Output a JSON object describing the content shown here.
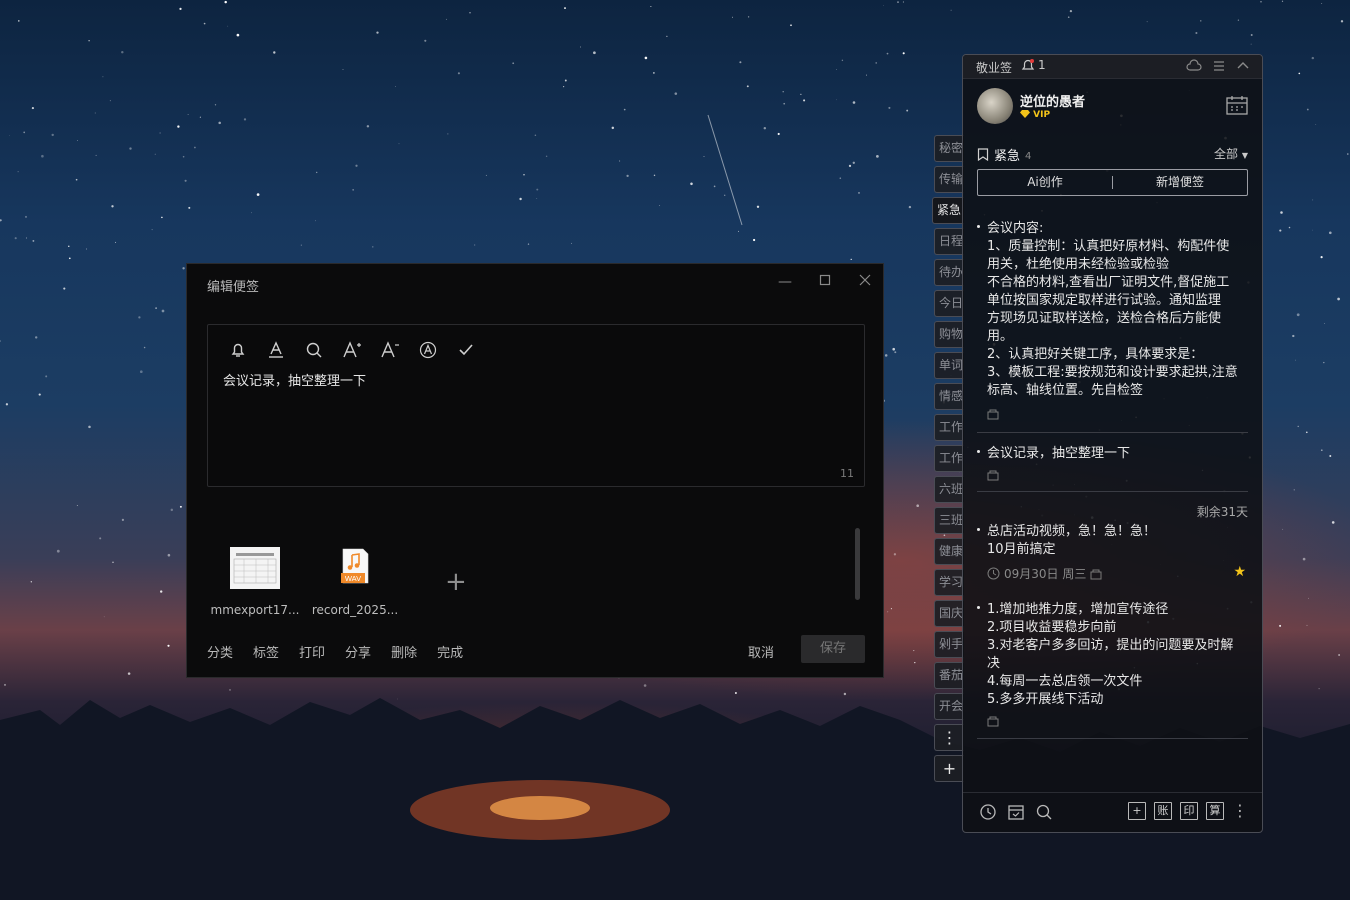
{
  "editor": {
    "title": "编辑便签",
    "toolbar": [
      "reminder-bell-icon",
      "text-format-icon",
      "search-icon",
      "font-increase-icon",
      "font-decrease-icon",
      "text-color-icon",
      "checklist-icon"
    ],
    "content": "会议记录，抽空整理一下",
    "char_count": "11",
    "attachments": [
      {
        "name": "mmexport17...",
        "type": "image"
      },
      {
        "name": "record_2025...",
        "type": "wav",
        "badge": "WAV"
      }
    ],
    "actions": [
      "分类",
      "标签",
      "打印",
      "分享",
      "删除",
      "完成"
    ],
    "cancel_label": "取消",
    "save_label": "保存"
  },
  "side_tabs": [
    {
      "label": "秘密"
    },
    {
      "label": "传输"
    },
    {
      "label": "紧急",
      "active": true
    },
    {
      "label": "日程"
    },
    {
      "label": "待办"
    },
    {
      "label": "今日"
    },
    {
      "label": "购物"
    },
    {
      "label": "单词"
    },
    {
      "label": "情感"
    },
    {
      "label": "工作"
    },
    {
      "label": "工作"
    },
    {
      "label": "六班"
    },
    {
      "label": "三班"
    },
    {
      "label": "健康"
    },
    {
      "label": "学习"
    },
    {
      "label": "国庆"
    },
    {
      "label": "剁手"
    },
    {
      "label": "番茄"
    },
    {
      "label": "开会"
    }
  ],
  "side_tools": {
    "more": "⋮",
    "add": "+"
  },
  "panel": {
    "app_name": "敬业签",
    "notification_count": "1",
    "user": {
      "name": "逆位的愚者",
      "badge": "VIP"
    },
    "category": {
      "label": "紧急",
      "count": "4"
    },
    "filter_label": "全部",
    "ai_button": "Ai创作",
    "new_button": "新增便签",
    "notes": [
      {
        "lines": [
          "会议内容:",
          "1、质量控制：认真把好原材料、构配件使",
          "用关，杜绝使用未经检验或检验",
          "不合格的材料,查看出厂证明文件,督促施工",
          "单位按国家规定取样进行试验。通知监理",
          "方现场见证取样送检，送检合格后方能使",
          "用。",
          "2、认真把好关键工序，具体要求是：",
          "3、模板工程:要按规范和设计要求起拱,注意",
          "标高、轴线位置。先自检签"
        ]
      },
      {
        "lines": [
          "会议记录，抽空整理一下"
        ]
      },
      {
        "remaining": "剩余31天",
        "lines": [
          "总店活动视频，急！急！急！",
          "10月前搞定"
        ],
        "date": "09月30日 周三",
        "starred": true
      },
      {
        "lines": [
          "1.增加地推力度，增加宣传途径",
          "2.项目收益要稳步向前",
          "3.对老客户多多回访，提出的问题要及时解",
          "决",
          "4.每周一去总店领一次文件",
          "5.多多开展线下活动"
        ]
      }
    ],
    "bottom_right": [
      "+",
      "账",
      "印",
      "算"
    ]
  },
  "colors": {
    "accent_star": "#f2c31a",
    "panel_bg": "#0e1014",
    "editor_bg": "#0b0b0c"
  }
}
